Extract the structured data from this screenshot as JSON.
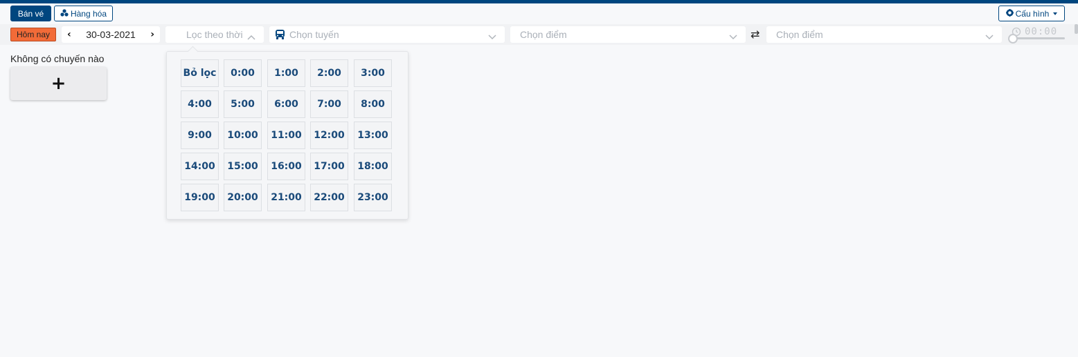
{
  "toolbar": {
    "sell_ticket_label": "Bán vé",
    "goods_label": "Hàng hóa",
    "config_label": "Cấu hình"
  },
  "filters": {
    "today_label": "Hôm nay",
    "date_value": "30-03-2021",
    "time_filter_placeholder": "Lọc theo thời",
    "route_placeholder": "Chọn tuyến",
    "from_point_placeholder": "Chọn điểm",
    "to_point_placeholder": "Chọn điểm",
    "time_value": "00:00"
  },
  "main": {
    "empty_message": "Không có chuyến nào",
    "add_label": "+"
  },
  "time_dropdown": {
    "options": [
      "Bỏ lọc",
      "0:00",
      "1:00",
      "2:00",
      "3:00",
      "4:00",
      "5:00",
      "6:00",
      "7:00",
      "8:00",
      "9:00",
      "10:00",
      "11:00",
      "12:00",
      "13:00",
      "14:00",
      "15:00",
      "16:00",
      "17:00",
      "18:00",
      "19:00",
      "20:00",
      "21:00",
      "22:00",
      "23:00"
    ]
  },
  "colors": {
    "primary": "#00467f",
    "today_button": "#f26b38",
    "tile_text": "#1a4a7a"
  },
  "icons": {
    "goods": "cubes-icon",
    "config": "gear-icon",
    "route": "bus-icon",
    "swap": "swap-icon",
    "time": "clock-icon"
  }
}
